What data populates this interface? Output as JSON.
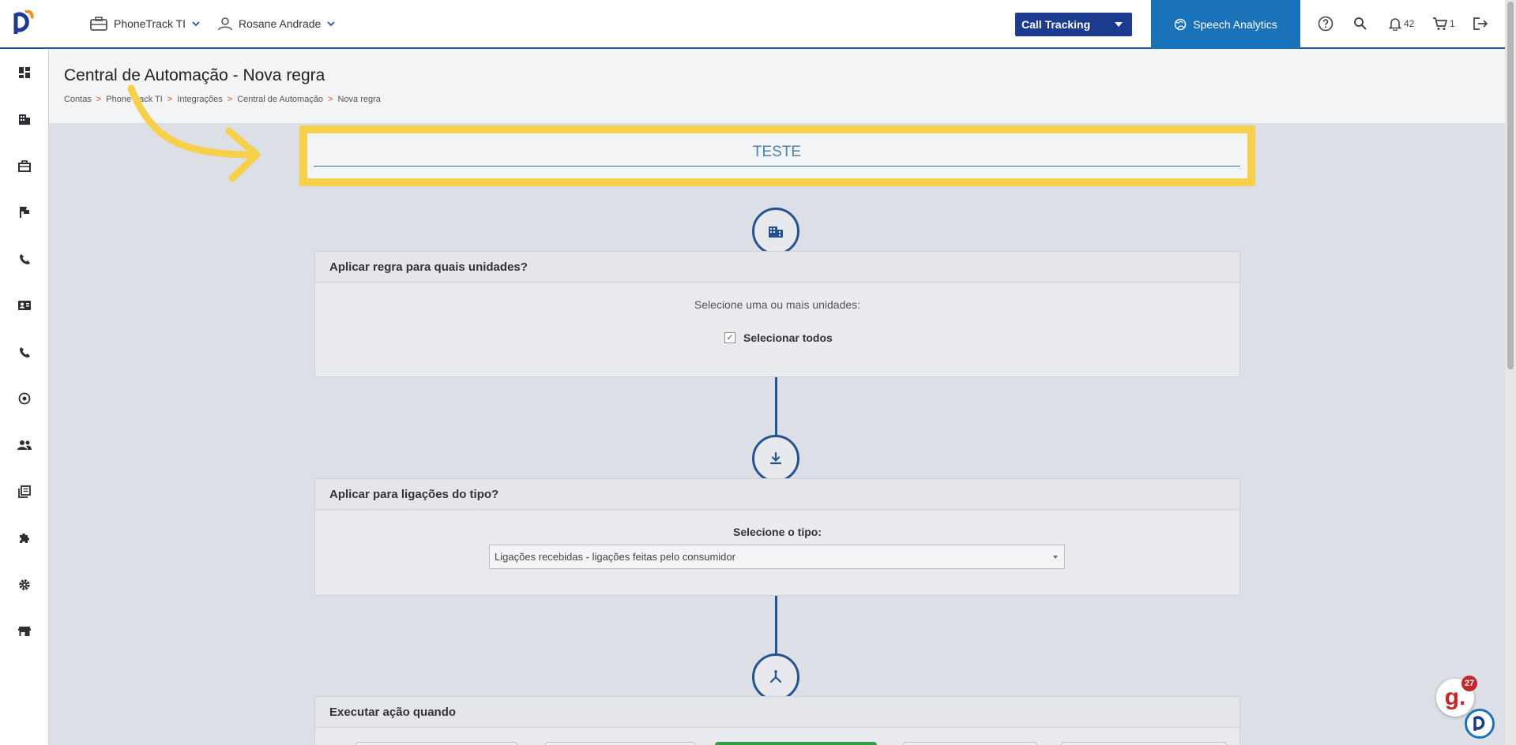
{
  "topbar": {
    "account_label": "PhoneTrack TI",
    "user_label": "Rosane Andrade",
    "product_select": "Call Tracking",
    "speech_label": "Speech Analytics",
    "notifications_count": "42",
    "cart_count": "1"
  },
  "page": {
    "title": "Central de Automação - Nova regra",
    "breadcrumb": [
      "Contas",
      "PhoneTrack TI",
      "Integrações",
      "Central de Automação",
      "Nova regra"
    ],
    "breadcrumb_sep": ">"
  },
  "rule_name": {
    "value": "TESTE"
  },
  "units_card": {
    "title": "Aplicar regra para quais unidades?",
    "helper": "Selecione uma ou mais unidades:",
    "select_all_label": "Selecionar todos",
    "select_all_checked": true
  },
  "type_card": {
    "title": "Aplicar para ligações do tipo?",
    "helper": "Selecione o tipo:",
    "selected_type": "Ligações recebidas - ligações feitas pelo consumidor"
  },
  "action_card": {
    "title": "Executar ação quando"
  },
  "chat_widget": {
    "letter": "g.",
    "badge_count": "27"
  },
  "colors": {
    "primary": "#24548f",
    "highlight": "#f7d04b",
    "speech_bg": "#1a72b8",
    "select_bg": "#1c3b8f",
    "breadcrumb_sep": "#d9461f"
  }
}
